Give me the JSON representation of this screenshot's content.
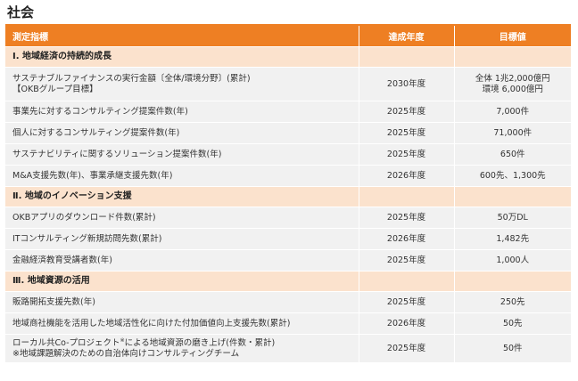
{
  "page": {
    "title": "社会"
  },
  "table": {
    "headers": [
      "測定指標",
      "達成年度",
      "目標値"
    ],
    "sections": [
      {
        "label": "Ⅰ. 地域経済の持続的成長",
        "rows": [
          {
            "indicator": [
              "サステナブルファイナンスの実行金額〔全体/環境分野〕(累計)",
              "【OKBグループ目標】"
            ],
            "year": "2030年度",
            "target": [
              "全体 1兆2,000億円",
              "環境 6,000億円"
            ]
          },
          {
            "indicator": [
              "事業先に対するコンサルティング提案件数(年)"
            ],
            "year": "2025年度",
            "target": [
              "7,000件"
            ]
          },
          {
            "indicator": [
              "個人に対するコンサルティング提案件数(年)"
            ],
            "year": "2025年度",
            "target": [
              "71,000件"
            ]
          },
          {
            "indicator": [
              "サステナビリティに関するソリューション提案件数(年)"
            ],
            "year": "2025年度",
            "target": [
              "650件"
            ]
          },
          {
            "indicator": [
              "M&A支援先数(年)、事業承継支援先数(年)"
            ],
            "year": "2026年度",
            "target": [
              "600先、1,300先"
            ]
          }
        ]
      },
      {
        "label": "Ⅱ. 地域のイノベーション支援",
        "rows": [
          {
            "indicator": [
              "OKBアプリのダウンロード件数(累計)"
            ],
            "year": "2025年度",
            "target": [
              "50万DL"
            ]
          },
          {
            "indicator": [
              "ITコンサルティング新規訪問先数(累計)"
            ],
            "year": "2026年度",
            "target": [
              "1,482先"
            ]
          },
          {
            "indicator": [
              "金融経済教育受講者数(年)"
            ],
            "year": "2025年度",
            "target": [
              "1,000人"
            ]
          }
        ]
      },
      {
        "label": "Ⅲ. 地域資源の活用",
        "rows": [
          {
            "indicator": [
              "販路開拓支援先数(年)"
            ],
            "year": "2025年度",
            "target": [
              "250先"
            ]
          },
          {
            "indicator": [
              "地域商社機能を活用した地域活性化に向けた付加価値向上支援先数(累計)"
            ],
            "year": "2026年度",
            "target": [
              "50先"
            ]
          },
          {
            "indicator": [
              "ローカル共Co-プロジェクト",
              "による地域資源の磨き上げ(件数・累計)",
              "※地域課題解決のための自治体向けコンサルティングチーム"
            ],
            "year": "2025年度",
            "target": [
              "50件"
            ],
            "footnote_mark": "※"
          }
        ]
      }
    ]
  }
}
